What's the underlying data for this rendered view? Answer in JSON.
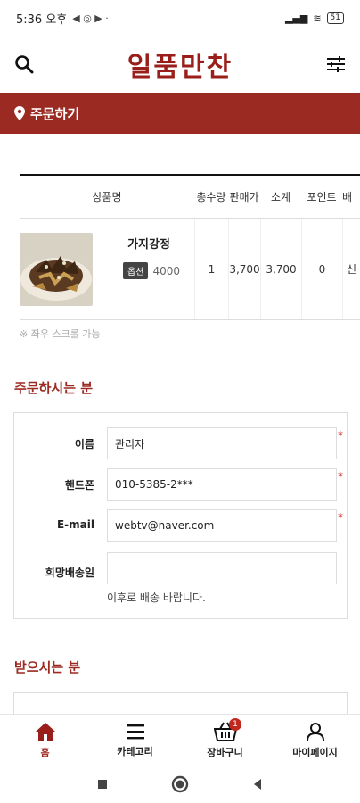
{
  "status_bar": {
    "time": "5:36 오후",
    "battery": "51"
  },
  "header": {
    "logo": "일품만찬"
  },
  "banner": {
    "title": "주문하기"
  },
  "order_table": {
    "headers": [
      "상품명",
      "총수량",
      "판매가",
      "소계",
      "포인트",
      "배"
    ],
    "rows": [
      {
        "name": "가지강정",
        "option_badge": "옵션",
        "option_price": "4000",
        "qty": "1",
        "price": "3,700",
        "subtotal": "3,700",
        "point": "0",
        "cut": "신"
      }
    ],
    "scroll_note": "※ 좌우 스크롤 가능"
  },
  "orderer": {
    "title": "주문하시는 분",
    "name_label": "이름",
    "name_value": "관리자",
    "phone_label": "핸드폰",
    "phone_value": "010-5385-2***",
    "email_label": "E-mail",
    "email_value": "webtv@naver.com",
    "delivery_label": "희망배송일",
    "delivery_value": "",
    "delivery_hint": "이후로 배송 바랍니다.",
    "required_mark": "*"
  },
  "receiver": {
    "title": "받으시는 분"
  },
  "bottom_nav": {
    "items": [
      {
        "label": "홈",
        "icon": "home-icon"
      },
      {
        "label": "카테고리",
        "icon": "menu-icon"
      },
      {
        "label": "장바구니",
        "icon": "basket-icon"
      },
      {
        "label": "마이페이지",
        "icon": "user-icon"
      }
    ],
    "cart_count": "1"
  },
  "colors": {
    "brand": "#9a1f1a",
    "banner": "#9a2a22"
  }
}
